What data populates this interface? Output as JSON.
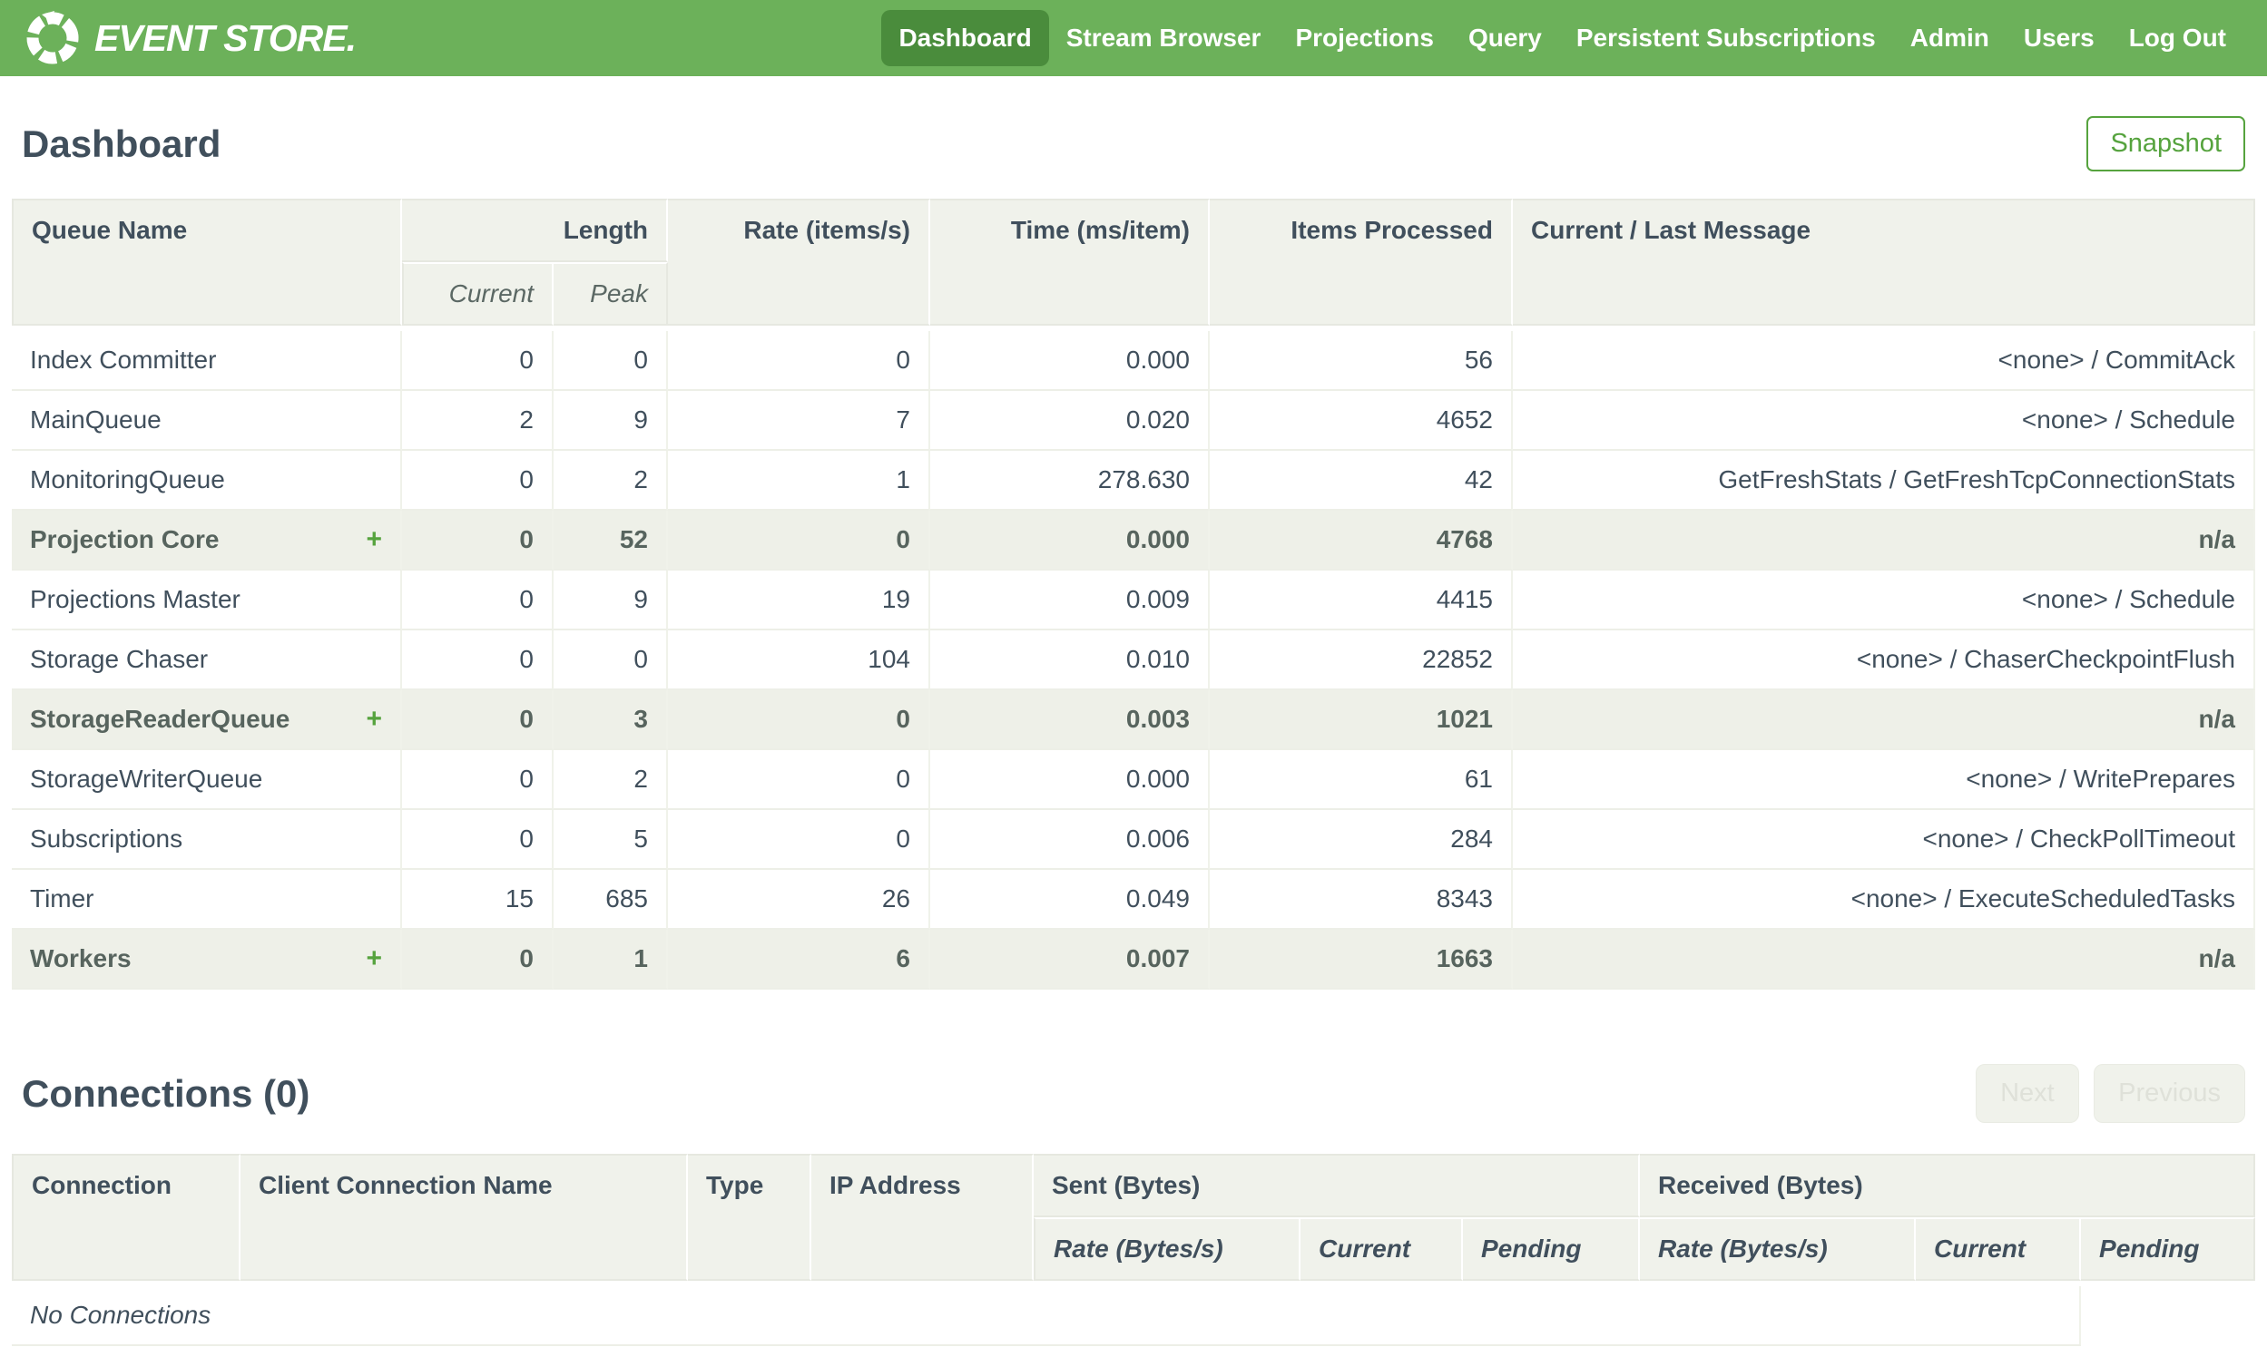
{
  "colors": {
    "nav_green": "#6cb15a",
    "nav_active": "#4a8c3c",
    "accent": "#56a33e",
    "text": "#404f5c",
    "header_bg": "#f0f2eb",
    "group_bg": "#eef0e8",
    "disabled_bg": "#f0f2eb",
    "disabled_text": "#dfe1d9"
  },
  "nav": {
    "brand": "EVENT STORE.",
    "items": [
      {
        "label": "Dashboard",
        "active": true
      },
      {
        "label": "Stream Browser",
        "active": false
      },
      {
        "label": "Projections",
        "active": false
      },
      {
        "label": "Query",
        "active": false
      },
      {
        "label": "Persistent Subscriptions",
        "active": false
      },
      {
        "label": "Admin",
        "active": false
      },
      {
        "label": "Users",
        "active": false
      },
      {
        "label": "Log Out",
        "active": false
      }
    ]
  },
  "page": {
    "title": "Dashboard",
    "snapshot_label": "Snapshot"
  },
  "queue_table": {
    "headers": {
      "queue_name": "Queue Name",
      "length": "Length",
      "current": "Current",
      "peak": "Peak",
      "rate": "Rate (items/s)",
      "time": "Time (ms/item)",
      "items_processed": "Items Processed",
      "message": "Current / Last Message"
    },
    "expand_icon": "+",
    "rows": [
      {
        "name": "Index Committer",
        "group": false,
        "current": "0",
        "peak": "0",
        "rate": "0",
        "time": "0.000",
        "items": "56",
        "message": "<none> / CommitAck"
      },
      {
        "name": "MainQueue",
        "group": false,
        "current": "2",
        "peak": "9",
        "rate": "7",
        "time": "0.020",
        "items": "4652",
        "message": "<none> / Schedule"
      },
      {
        "name": "MonitoringQueue",
        "group": false,
        "current": "0",
        "peak": "2",
        "rate": "1",
        "time": "278.630",
        "items": "42",
        "message": "GetFreshStats / GetFreshTcpConnectionStats"
      },
      {
        "name": "Projection Core",
        "group": true,
        "current": "0",
        "peak": "52",
        "rate": "0",
        "time": "0.000",
        "items": "4768",
        "message": "n/a"
      },
      {
        "name": "Projections Master",
        "group": false,
        "current": "0",
        "peak": "9",
        "rate": "19",
        "time": "0.009",
        "items": "4415",
        "message": "<none> / Schedule"
      },
      {
        "name": "Storage Chaser",
        "group": false,
        "current": "0",
        "peak": "0",
        "rate": "104",
        "time": "0.010",
        "items": "22852",
        "message": "<none> / ChaserCheckpointFlush"
      },
      {
        "name": "StorageReaderQueue",
        "group": true,
        "current": "0",
        "peak": "3",
        "rate": "0",
        "time": "0.003",
        "items": "1021",
        "message": "n/a"
      },
      {
        "name": "StorageWriterQueue",
        "group": false,
        "current": "0",
        "peak": "2",
        "rate": "0",
        "time": "0.000",
        "items": "61",
        "message": "<none> / WritePrepares"
      },
      {
        "name": "Subscriptions",
        "group": false,
        "current": "0",
        "peak": "5",
        "rate": "0",
        "time": "0.006",
        "items": "284",
        "message": "<none> / CheckPollTimeout"
      },
      {
        "name": "Timer",
        "group": false,
        "current": "15",
        "peak": "685",
        "rate": "26",
        "time": "0.049",
        "items": "8343",
        "message": "<none> / ExecuteScheduledTasks"
      },
      {
        "name": "Workers",
        "group": true,
        "current": "0",
        "peak": "1",
        "rate": "6",
        "time": "0.007",
        "items": "1663",
        "message": "n/a"
      }
    ]
  },
  "connections": {
    "title": "Connections (0)",
    "next_label": "Next",
    "previous_label": "Previous",
    "headers": {
      "connection": "Connection",
      "client": "Client Connection Name",
      "type": "Type",
      "ip": "IP Address",
      "sent": "Sent (Bytes)",
      "received": "Received (Bytes)",
      "rate": "Rate (Bytes/s)",
      "current": "Current",
      "pending": "Pending"
    },
    "empty_message": "No Connections"
  }
}
